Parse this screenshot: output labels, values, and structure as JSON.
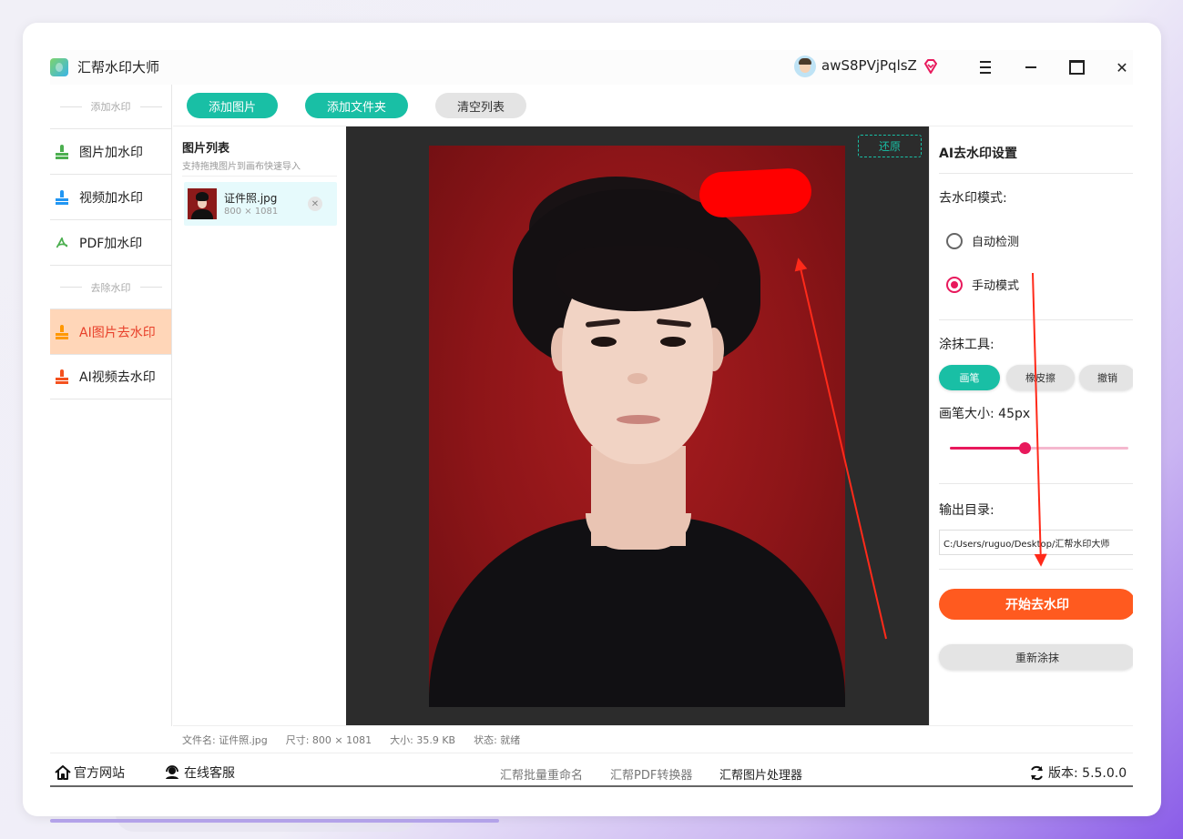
{
  "app": {
    "title": "汇帮水印大师",
    "user_name": "awS8PVjPqlsZ"
  },
  "sidebar": {
    "section_add": "添加水印",
    "section_remove": "去除水印",
    "items": [
      {
        "label": "图片加水印",
        "icon": "stamp-icon",
        "color": "#4caf50"
      },
      {
        "label": "视频加水印",
        "icon": "stamp-icon",
        "color": "#2196f3"
      },
      {
        "label": "PDF加水印",
        "icon": "pdf-icon",
        "color": "#4caf50"
      },
      {
        "label": "AI图片去水印",
        "icon": "stamp-icon",
        "color": "#ff9800",
        "active": true
      },
      {
        "label": "AI视频去水印",
        "icon": "stamp-icon",
        "color": "#f4511e"
      }
    ]
  },
  "toolbar": {
    "add_image": "添加图片",
    "add_folder": "添加文件夹",
    "clear_list": "清空列表"
  },
  "image_list": {
    "title": "图片列表",
    "hint": "支持拖拽图片到画布快速导入",
    "files": [
      {
        "name": "证件照.jpg",
        "dims": "800 × 1081"
      }
    ]
  },
  "canvas": {
    "restore": "还原"
  },
  "settings": {
    "title": "AI去水印设置",
    "mode_label": "去水印模式:",
    "mode_auto": "自动检测",
    "mode_manual": "手动模式",
    "mode_selected": "手动模式",
    "tool_label": "涂抹工具:",
    "tool_brush": "画笔",
    "tool_eraser": "橡皮擦",
    "tool_undo": "撤销",
    "brush_size_label": "画笔大小: 45px",
    "brush_size_fraction": 0.42,
    "output_label": "输出目录:",
    "output_path": "C:/Users/ruguo/Desktop/汇帮水印大师",
    "start": "开始去水印",
    "redo": "重新涂抹"
  },
  "status": {
    "filename": "文件名: 证件照.jpg",
    "size": "尺寸: 800 × 1081",
    "filesize": "大小: 35.9 KB",
    "state": "状态: 就绪"
  },
  "footer": {
    "website": "官方网站",
    "support": "在线客服",
    "tool1": "汇帮批量重命名",
    "tool2": "汇帮PDF转换器",
    "tool3": "汇帮图片处理器",
    "version": "版本: 5.5.0.0"
  },
  "colors": {
    "accent": "#19bfa5",
    "active_item_bg": "#ffd6b8",
    "primary_action": "#ff5a1f",
    "radio_and_slider": "#e8195c",
    "annotation_arrow": "#ff2a1a"
  }
}
